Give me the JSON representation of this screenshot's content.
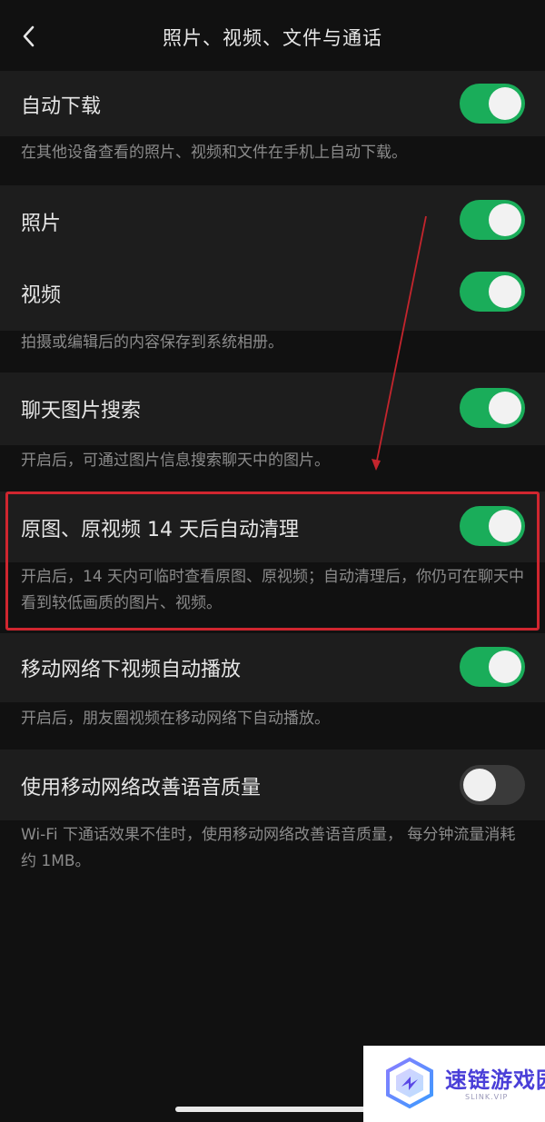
{
  "header": {
    "title": "照片、视频、文件与通话"
  },
  "settings": {
    "auto_download": {
      "label": "自动下载",
      "enabled": true
    },
    "auto_download_desc": "在其他设备查看的照片、视频和文件在手机上自动下载。",
    "photos": {
      "label": "照片",
      "enabled": true
    },
    "videos": {
      "label": "视频",
      "enabled": true
    },
    "save_desc": "拍摄或编辑后的内容保存到系统相册。",
    "chat_image_search": {
      "label": "聊天图片搜索",
      "enabled": true
    },
    "chat_image_search_desc": "开启后，可通过图片信息搜索聊天中的图片。",
    "auto_clean": {
      "label": "原图、原视频 14 天后自动清理",
      "enabled": true
    },
    "auto_clean_desc": "开启后，14 天内可临时查看原图、原视频；自动清理后，你仍可在聊天中看到较低画质的图片、视频。",
    "mobile_autoplay": {
      "label": "移动网络下视频自动播放",
      "enabled": true
    },
    "mobile_autoplay_desc": "开启后，朋友圈视频在移动网络下自动播放。",
    "voice_quality": {
      "label": "使用移动网络改善语音质量",
      "enabled": false
    },
    "voice_quality_desc": "Wi-Fi 下通话效果不佳时，使用移动网络改善语音质量， 每分钟流量消耗约 1MB。"
  },
  "watermark": {
    "name": "速链游戏园",
    "domain": "SLINK.VIP"
  },
  "colors": {
    "toggle_on": "#1aad5a",
    "toggle_off": "#3a3a3a",
    "highlight": "#d0262f",
    "watermark_brand": "#4a3fd8"
  }
}
